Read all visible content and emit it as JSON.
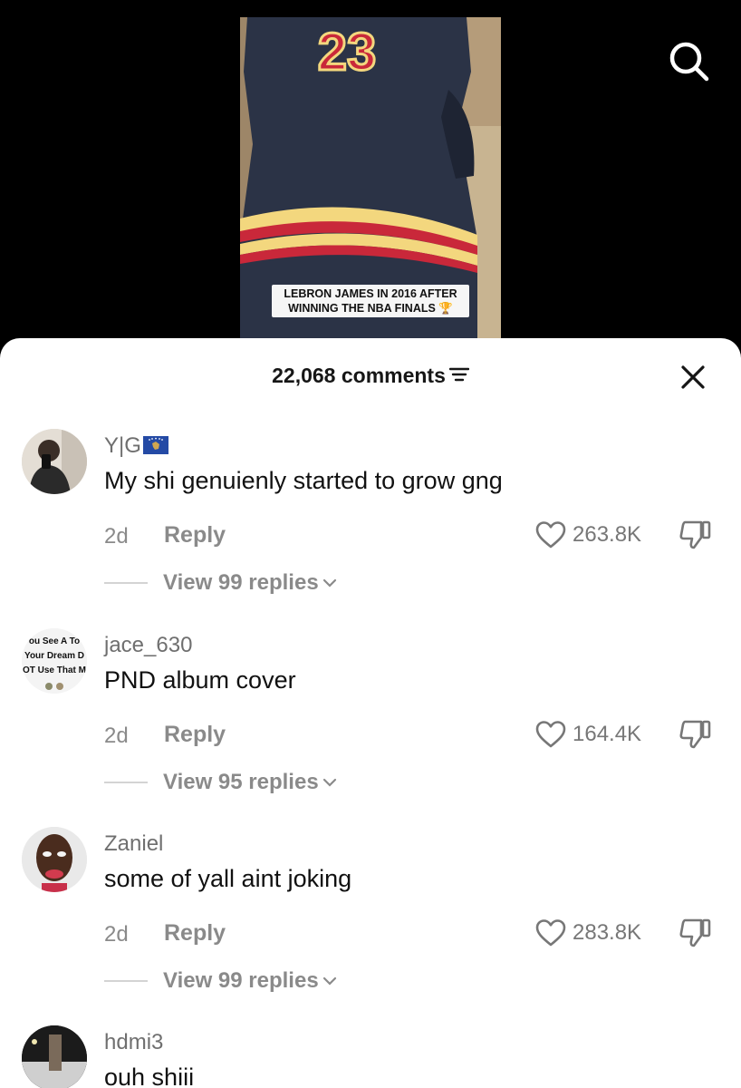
{
  "video": {
    "caption_line1": "LEBRON JAMES IN 2016 AFTER",
    "caption_line2": "WINNING THE NBA FINALS",
    "caption_emoji": "🏆",
    "jersey_number": "23"
  },
  "icons": {
    "search": "search-icon",
    "filter": "filter-icon",
    "close": "close-icon",
    "like": "heart-icon",
    "dislike": "thumbs-down-icon",
    "chevron": "chevron-down-icon"
  },
  "sheet": {
    "comment_count": "22,068 comments"
  },
  "comments": [
    {
      "username": "Y|G",
      "text": "My shi genuienly started to grow gng",
      "age": "2d",
      "reply_label": "Reply",
      "likes": "263.8K",
      "view_replies": "View 99 replies"
    },
    {
      "username": "jace_630",
      "avatar_text_1": "ou See A To",
      "avatar_text_2": "Your Dream D",
      "avatar_text_3": "OT Use That M",
      "text": "PND album cover",
      "age": "2d",
      "reply_label": "Reply",
      "likes": "164.4K",
      "view_replies": "View 95 replies"
    },
    {
      "username": "Zaniel",
      "text": "some of yall aint joking",
      "age": "2d",
      "reply_label": "Reply",
      "likes": "283.8K",
      "view_replies": "View 99 replies"
    },
    {
      "username": "hdmi3",
      "text": "ouh shiii"
    }
  ],
  "colors": {
    "jersey": "#2b3346",
    "jersey_number": "#c9283a",
    "stripe_gold": "#f3d77e",
    "sheet_bg": "#ffffff",
    "muted_text": "#8a8a8a"
  }
}
